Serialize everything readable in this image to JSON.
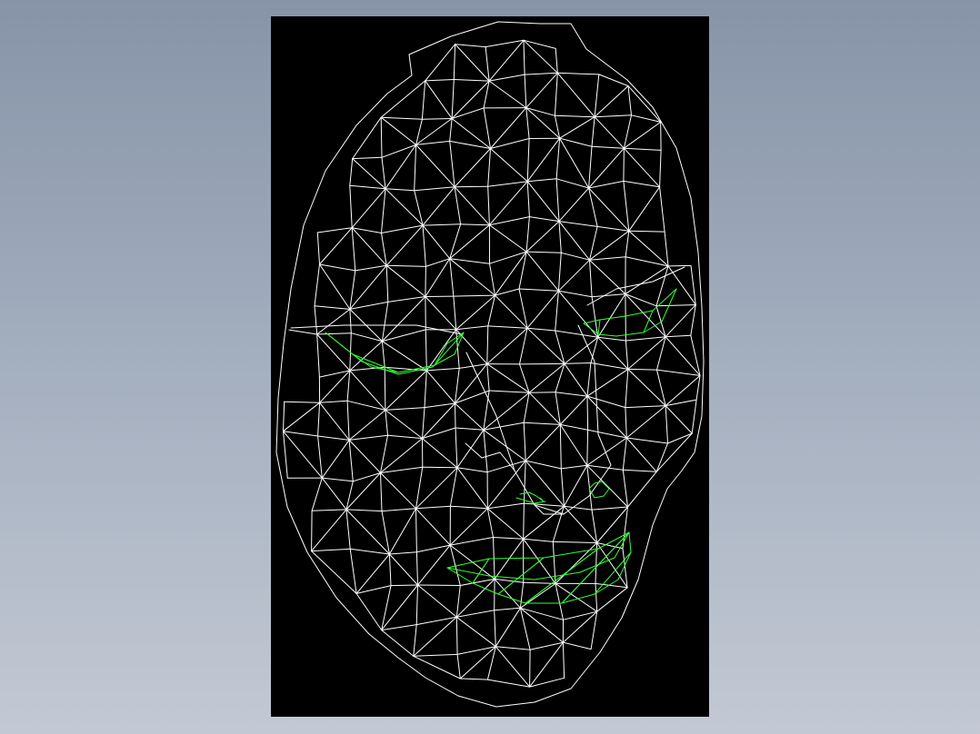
{
  "scene": {
    "subject": "face-mesh",
    "render_mode": "wireframe",
    "colors": {
      "background_top": "#8794a8",
      "background_bottom": "#c3c9d4",
      "viewport": "#000000",
      "mesh": "#ffffff",
      "features": "#33ff33"
    },
    "features": [
      "left-eye",
      "right-eye",
      "nostril-left",
      "nostril-right",
      "mouth"
    ]
  }
}
